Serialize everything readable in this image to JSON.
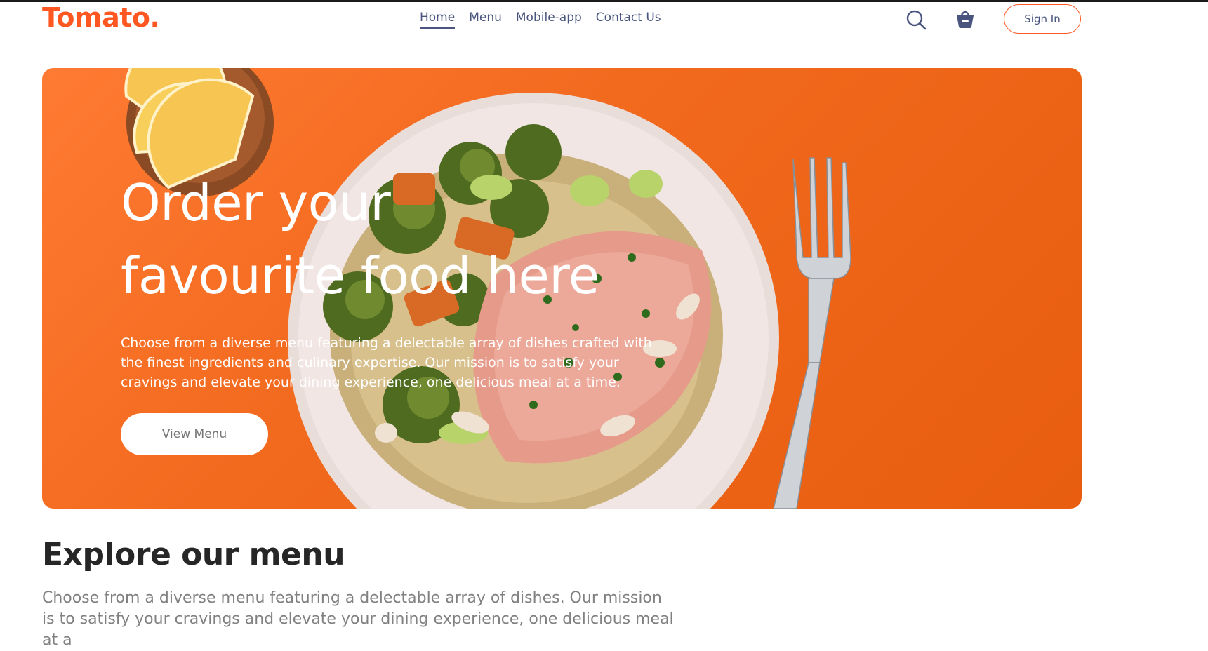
{
  "brand": {
    "logo": "Tomato.",
    "accent": "#ff5722"
  },
  "navbar": {
    "menu": [
      {
        "label": "Home",
        "active": true
      },
      {
        "label": "Menu",
        "active": false
      },
      {
        "label": "Mobile-app",
        "active": false
      },
      {
        "label": "Contact Us",
        "active": false
      }
    ],
    "icons": [
      "search-icon",
      "basket-icon"
    ],
    "signin_label": "Sign In"
  },
  "hero": {
    "title_line1": "Order your",
    "title_line2": "favourite food here",
    "description": "Choose from a diverse menu featuring a delectable array of dishes crafted with the finest ingredients and culinary expertise. Our mission is to satisfy your cravings and elevate your dining experience, one delicious meal at a time.",
    "button_label": "View Menu"
  },
  "explore": {
    "title": "Explore our menu",
    "description": "Choose from a diverse menu featuring a delectable array of dishes. Our mission is to satisfy your cravings and elevate your dining experience, one delicious meal at a"
  }
}
